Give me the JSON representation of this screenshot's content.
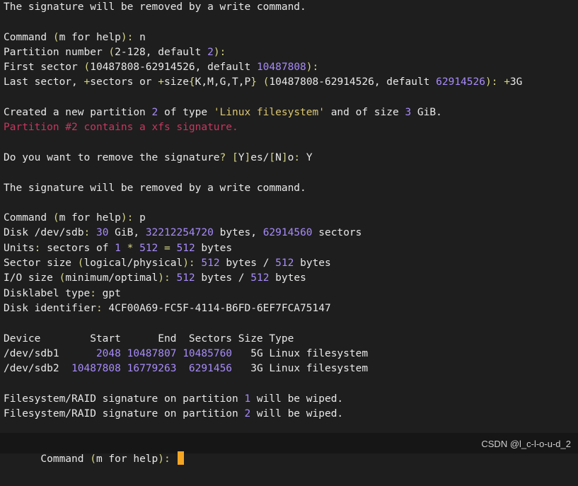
{
  "colors": {
    "background": "#1e1e1e",
    "text": "#e8e8e8",
    "punctuation": "#d7d787",
    "number": "#a78bfa",
    "string": "#dcc66e",
    "warning": "#c8375f",
    "cursor": "#f5a623"
  },
  "lines": [
    {
      "segs": [
        {
          "c": "p",
          "t": "The signature will be removed by a write command."
        }
      ]
    },
    {
      "segs": []
    },
    {
      "segs": [
        {
          "c": "p",
          "t": "Command "
        },
        {
          "c": "y",
          "t": "("
        },
        {
          "c": "p",
          "t": "m for help"
        },
        {
          "c": "y",
          "t": "):"
        },
        {
          "c": "p",
          "t": " n"
        }
      ]
    },
    {
      "segs": [
        {
          "c": "p",
          "t": "Partition number "
        },
        {
          "c": "y",
          "t": "("
        },
        {
          "c": "p",
          "t": "2-128, default "
        },
        {
          "c": "n",
          "t": "2"
        },
        {
          "c": "y",
          "t": "):"
        }
      ]
    },
    {
      "segs": [
        {
          "c": "p",
          "t": "First sector "
        },
        {
          "c": "y",
          "t": "("
        },
        {
          "c": "p",
          "t": "10487808-62914526, default "
        },
        {
          "c": "n",
          "t": "10487808"
        },
        {
          "c": "y",
          "t": "):"
        }
      ]
    },
    {
      "segs": [
        {
          "c": "p",
          "t": "Last sector, "
        },
        {
          "c": "y",
          "t": "+"
        },
        {
          "c": "p",
          "t": "sectors or "
        },
        {
          "c": "y",
          "t": "+"
        },
        {
          "c": "p",
          "t": "size"
        },
        {
          "c": "y",
          "t": "{"
        },
        {
          "c": "p",
          "t": "K,M,G,T,P"
        },
        {
          "c": "y",
          "t": "}"
        },
        {
          "c": "p",
          "t": " "
        },
        {
          "c": "y",
          "t": "("
        },
        {
          "c": "p",
          "t": "10487808-62914526, default "
        },
        {
          "c": "n",
          "t": "62914526"
        },
        {
          "c": "y",
          "t": "):"
        },
        {
          "c": "p",
          "t": " "
        },
        {
          "c": "y",
          "t": "+"
        },
        {
          "c": "p",
          "t": "3G"
        }
      ]
    },
    {
      "segs": []
    },
    {
      "segs": [
        {
          "c": "p",
          "t": "Created a new partition "
        },
        {
          "c": "n",
          "t": "2"
        },
        {
          "c": "p",
          "t": " of type "
        },
        {
          "c": "s",
          "t": "'Linux filesystem'"
        },
        {
          "c": "p",
          "t": " and of size "
        },
        {
          "c": "n",
          "t": "3"
        },
        {
          "c": "p",
          "t": " GiB."
        }
      ]
    },
    {
      "segs": [
        {
          "c": "r",
          "t": "Partition #2 contains a xfs signature."
        }
      ]
    },
    {
      "segs": []
    },
    {
      "segs": [
        {
          "c": "p",
          "t": "Do you want to remove the signature"
        },
        {
          "c": "y",
          "t": "?"
        },
        {
          "c": "p",
          "t": " "
        },
        {
          "c": "y",
          "t": "["
        },
        {
          "c": "p",
          "t": "Y"
        },
        {
          "c": "y",
          "t": "]"
        },
        {
          "c": "p",
          "t": "es/"
        },
        {
          "c": "y",
          "t": "["
        },
        {
          "c": "p",
          "t": "N"
        },
        {
          "c": "y",
          "t": "]"
        },
        {
          "c": "p",
          "t": "o"
        },
        {
          "c": "y",
          "t": ":"
        },
        {
          "c": "p",
          "t": " Y"
        }
      ]
    },
    {
      "segs": []
    },
    {
      "segs": [
        {
          "c": "p",
          "t": "The signature will be removed by a write command."
        }
      ]
    },
    {
      "segs": []
    },
    {
      "segs": [
        {
          "c": "p",
          "t": "Command "
        },
        {
          "c": "y",
          "t": "("
        },
        {
          "c": "p",
          "t": "m for help"
        },
        {
          "c": "y",
          "t": "):"
        },
        {
          "c": "p",
          "t": " p"
        }
      ]
    },
    {
      "segs": [
        {
          "c": "p",
          "t": "Disk /dev/sdb"
        },
        {
          "c": "y",
          "t": ":"
        },
        {
          "c": "p",
          "t": " "
        },
        {
          "c": "n",
          "t": "30"
        },
        {
          "c": "p",
          "t": " GiB, "
        },
        {
          "c": "n",
          "t": "32212254720"
        },
        {
          "c": "p",
          "t": " bytes, "
        },
        {
          "c": "n",
          "t": "62914560"
        },
        {
          "c": "p",
          "t": " sectors"
        }
      ]
    },
    {
      "segs": [
        {
          "c": "p",
          "t": "Units"
        },
        {
          "c": "y",
          "t": ":"
        },
        {
          "c": "p",
          "t": " sectors of "
        },
        {
          "c": "n",
          "t": "1"
        },
        {
          "c": "p",
          "t": " "
        },
        {
          "c": "y",
          "t": "*"
        },
        {
          "c": "p",
          "t": " "
        },
        {
          "c": "n",
          "t": "512"
        },
        {
          "c": "p",
          "t": " "
        },
        {
          "c": "y",
          "t": "="
        },
        {
          "c": "p",
          "t": " "
        },
        {
          "c": "n",
          "t": "512"
        },
        {
          "c": "p",
          "t": " bytes"
        }
      ]
    },
    {
      "segs": [
        {
          "c": "p",
          "t": "Sector size "
        },
        {
          "c": "y",
          "t": "("
        },
        {
          "c": "p",
          "t": "logical/physical"
        },
        {
          "c": "y",
          "t": "):"
        },
        {
          "c": "p",
          "t": " "
        },
        {
          "c": "n",
          "t": "512"
        },
        {
          "c": "p",
          "t": " bytes / "
        },
        {
          "c": "n",
          "t": "512"
        },
        {
          "c": "p",
          "t": " bytes"
        }
      ]
    },
    {
      "segs": [
        {
          "c": "p",
          "t": "I/O size "
        },
        {
          "c": "y",
          "t": "("
        },
        {
          "c": "p",
          "t": "minimum/optimal"
        },
        {
          "c": "y",
          "t": "):"
        },
        {
          "c": "p",
          "t": " "
        },
        {
          "c": "n",
          "t": "512"
        },
        {
          "c": "p",
          "t": " bytes / "
        },
        {
          "c": "n",
          "t": "512"
        },
        {
          "c": "p",
          "t": " bytes"
        }
      ]
    },
    {
      "segs": [
        {
          "c": "p",
          "t": "Disklabel type"
        },
        {
          "c": "y",
          "t": ":"
        },
        {
          "c": "p",
          "t": " gpt"
        }
      ]
    },
    {
      "segs": [
        {
          "c": "p",
          "t": "Disk identifier"
        },
        {
          "c": "y",
          "t": ":"
        },
        {
          "c": "p",
          "t": " 4CF00A69-FC5F-4114-B6FD-6EF7FCA75147"
        }
      ]
    },
    {
      "segs": []
    },
    {
      "segs": [
        {
          "c": "p",
          "t": "Device        Start      End  Sectors Size Type"
        }
      ]
    },
    {
      "segs": [
        {
          "c": "p",
          "t": "/dev/sdb1      "
        },
        {
          "c": "n",
          "t": "2048"
        },
        {
          "c": "p",
          "t": " "
        },
        {
          "c": "n",
          "t": "10487807"
        },
        {
          "c": "p",
          "t": " "
        },
        {
          "c": "n",
          "t": "10485760"
        },
        {
          "c": "p",
          "t": "   5G Linux filesystem"
        }
      ]
    },
    {
      "segs": [
        {
          "c": "p",
          "t": "/dev/sdb2  "
        },
        {
          "c": "n",
          "t": "10487808"
        },
        {
          "c": "p",
          "t": " "
        },
        {
          "c": "n",
          "t": "16779263"
        },
        {
          "c": "p",
          "t": "  "
        },
        {
          "c": "n",
          "t": "6291456"
        },
        {
          "c": "p",
          "t": "   3G Linux filesystem"
        }
      ]
    },
    {
      "segs": []
    },
    {
      "segs": [
        {
          "c": "p",
          "t": "Filesystem/RAID signature on partition "
        },
        {
          "c": "n",
          "t": "1"
        },
        {
          "c": "p",
          "t": " will be wiped."
        }
      ]
    },
    {
      "segs": [
        {
          "c": "p",
          "t": "Filesystem/RAID signature on partition "
        },
        {
          "c": "n",
          "t": "2"
        },
        {
          "c": "p",
          "t": " will be wiped."
        }
      ]
    }
  ],
  "prompt": {
    "segs": [
      {
        "c": "p",
        "t": "Command "
      },
      {
        "c": "y",
        "t": "("
      },
      {
        "c": "p",
        "t": "m for help"
      },
      {
        "c": "y",
        "t": "):"
      },
      {
        "c": "p",
        "t": " "
      }
    ]
  },
  "watermark": "CSDN @l_c-l-o-u-d_2"
}
